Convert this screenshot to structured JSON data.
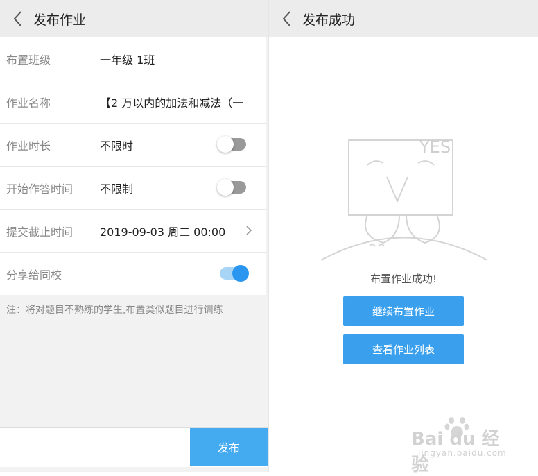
{
  "left": {
    "header": {
      "title": "发布作业"
    },
    "form": [
      {
        "label": "布置班级",
        "value": "一年级 1班"
      },
      {
        "label": "作业名称",
        "value": "【2 万以内的加法和减法（一"
      },
      {
        "label": "作业时长",
        "value": "不限时",
        "toggle": false
      },
      {
        "label": "开始作答时间",
        "value": "不限制",
        "toggle": false
      },
      {
        "label": "提交截止时间",
        "value": "2019-09-03 周二 00:00"
      },
      {
        "label": "分享给同校",
        "value": "",
        "toggle": true
      }
    ],
    "note": "注：将对题目不熟练的学生,布置类似题目进行训练",
    "publish_label": "发布"
  },
  "right": {
    "header": {
      "title": "发布成功"
    },
    "illustration_text": "YES",
    "success_text": "布置作业成功!",
    "continue_label": "继续布置作业",
    "list_label": "查看作业列表"
  },
  "watermark": {
    "main": "Bai du 经验",
    "sub": "jingyan.baidu.com"
  },
  "colors": {
    "accent": "#2b96ef",
    "button": "#3aa0ee",
    "header_bg": "#ececec"
  }
}
